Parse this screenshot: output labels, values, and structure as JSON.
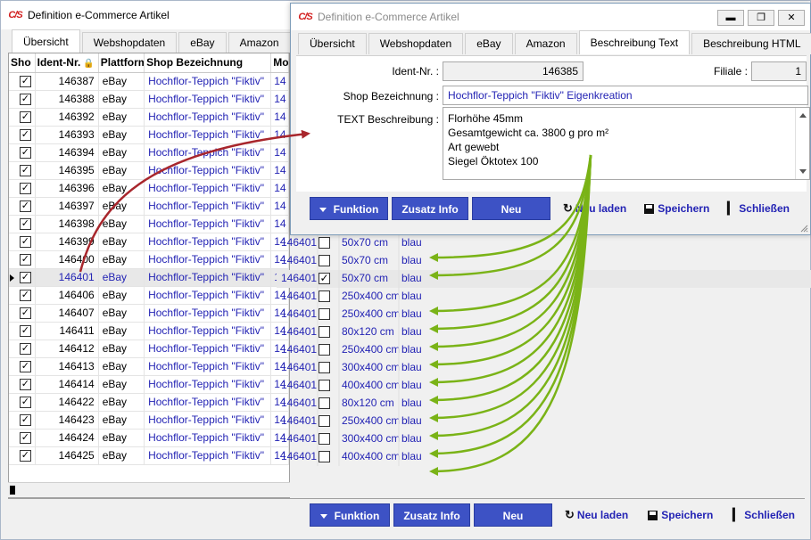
{
  "back_window": {
    "title": "Definition e-Commerce Artikel",
    "logo": "C/S",
    "tabs": [
      "Übersicht",
      "Webshopdaten",
      "eBay",
      "Amazon"
    ],
    "columns": [
      "Sho",
      "Ident-Nr.",
      "Plattform",
      "Shop Bezeichnung",
      "Mo"
    ],
    "rows": [
      {
        "id": "146387",
        "platform": "eBay",
        "name": "Hochflor-Teppich \"Fiktiv\"",
        "mo": "14"
      },
      {
        "id": "146388",
        "platform": "eBay",
        "name": "Hochflor-Teppich \"Fiktiv\"",
        "mo": "14"
      },
      {
        "id": "146392",
        "platform": "eBay",
        "name": "Hochflor-Teppich \"Fiktiv\"",
        "mo": "14"
      },
      {
        "id": "146393",
        "platform": "eBay",
        "name": "Hochflor-Teppich \"Fiktiv\"",
        "mo": "14"
      },
      {
        "id": "146394",
        "platform": "eBay",
        "name": "Hochflor-Teppich \"Fiktiv\"",
        "mo": "14"
      },
      {
        "id": "146395",
        "platform": "eBay",
        "name": "Hochflor-Teppich \"Fiktiv\"",
        "mo": "14"
      },
      {
        "id": "146396",
        "platform": "eBay",
        "name": "Hochflor-Teppich \"Fiktiv\"",
        "mo": "14"
      },
      {
        "id": "146397",
        "platform": "eBay",
        "name": "Hochflor-Teppich \"Fiktiv\"",
        "mo": "14"
      },
      {
        "id": "146398",
        "platform": "eBay",
        "name": "Hochflor-Teppich \"Fiktiv\"",
        "mo": "14"
      },
      {
        "id": "146399",
        "platform": "eBay",
        "name": "Hochflor-Teppich \"Fiktiv\"",
        "mo": "14"
      },
      {
        "id": "146400",
        "platform": "eBay",
        "name": "Hochflor-Teppich \"Fiktiv\"",
        "mo": "14"
      },
      {
        "id": "146401",
        "platform": "eBay",
        "name": "Hochflor-Teppich \"Fiktiv\"",
        "mo": "14"
      },
      {
        "id": "146406",
        "platform": "eBay",
        "name": "Hochflor-Teppich \"Fiktiv\"",
        "mo": "14"
      },
      {
        "id": "146407",
        "platform": "eBay",
        "name": "Hochflor-Teppich \"Fiktiv\"",
        "mo": "14"
      },
      {
        "id": "146411",
        "platform": "eBay",
        "name": "Hochflor-Teppich \"Fiktiv\"",
        "mo": "14"
      },
      {
        "id": "146412",
        "platform": "eBay",
        "name": "Hochflor-Teppich \"Fiktiv\"",
        "mo": "14"
      },
      {
        "id": "146413",
        "platform": "eBay",
        "name": "Hochflor-Teppich \"Fiktiv\"",
        "mo": "14"
      },
      {
        "id": "146414",
        "platform": "eBay",
        "name": "Hochflor-Teppich \"Fiktiv\"",
        "mo": "14"
      },
      {
        "id": "146422",
        "platform": "eBay",
        "name": "Hochflor-Teppich \"Fiktiv\"",
        "mo": "14"
      },
      {
        "id": "146423",
        "platform": "eBay",
        "name": "Hochflor-Teppich \"Fiktiv\"",
        "mo": "14"
      },
      {
        "id": "146424",
        "platform": "eBay",
        "name": "Hochflor-Teppich \"Fiktiv\"",
        "mo": "14"
      },
      {
        "id": "146425",
        "platform": "eBay",
        "name": "Hochflor-Teppich \"Fiktiv\"",
        "mo": "14"
      }
    ],
    "extended_rows": [
      {
        "ref": "146401",
        "checked": false,
        "size": "50x70 cm",
        "color": "blau"
      },
      {
        "ref": "146401",
        "checked": false,
        "size": "50x70 cm",
        "color": "blau"
      },
      {
        "ref": "146401",
        "checked": true,
        "size": "50x70 cm",
        "color": "blau"
      },
      {
        "ref": "146401",
        "checked": false,
        "size": "250x400 cm",
        "color": "blau"
      },
      {
        "ref": "146401",
        "checked": false,
        "size": "250x400 cm",
        "color": "blau"
      },
      {
        "ref": "146401",
        "checked": false,
        "size": "80x120 cm",
        "color": "blau"
      },
      {
        "ref": "146401",
        "checked": false,
        "size": "250x400 cm",
        "color": "blau"
      },
      {
        "ref": "146401",
        "checked": false,
        "size": "300x400 cm",
        "color": "blau"
      },
      {
        "ref": "146401",
        "checked": false,
        "size": "400x400 cm",
        "color": "blau"
      },
      {
        "ref": "146401",
        "checked": false,
        "size": "80x120 cm",
        "color": "blau"
      },
      {
        "ref": "146401",
        "checked": false,
        "size": "250x400 cm",
        "color": "blau"
      },
      {
        "ref": "146401",
        "checked": false,
        "size": "300x400 cm",
        "color": "blau"
      },
      {
        "ref": "146401",
        "checked": false,
        "size": "400x400 cm",
        "color": "blau"
      }
    ],
    "buttons": {
      "funktion": "Funktion",
      "zusatz": "Zusatz Info",
      "neu": "Neu",
      "neu_laden": "Neu laden",
      "speichern": "Speichern",
      "schliessen": "Schließen"
    }
  },
  "front_window": {
    "title": "Definition e-Commerce Artikel",
    "logo": "C/S",
    "tabs": [
      "Übersicht",
      "Webshopdaten",
      "eBay",
      "Amazon",
      "Beschreibung Text",
      "Beschreibung HTML"
    ],
    "ident_label": "Ident-Nr. :",
    "ident_value": "146385",
    "filiale_label": "Filiale :",
    "filiale_value": "1",
    "shop_label": "Shop Bezeichnung :",
    "shop_value": "Hochflor-Teppich \"Fiktiv\" Eigenkreation",
    "text_label": "TEXT Beschreibung :",
    "text_lines": [
      "Florhöhe 45mm",
      "Gesamtgewicht ca. 3800 g pro m²",
      "Art gewebt",
      "Siegel Öktotex 100"
    ],
    "buttons": {
      "funktion": "Funktion",
      "zusatz": "Zusatz Info",
      "neu": "Neu",
      "neu_laden": "Neu laden",
      "speichern": "Speichern",
      "schliessen": "Schließen"
    }
  },
  "colors": {
    "accent_button": "#3d52c5",
    "link_blue": "#2323b4",
    "arrow_green": "#7ab317",
    "arrow_red": "#a8262c"
  }
}
